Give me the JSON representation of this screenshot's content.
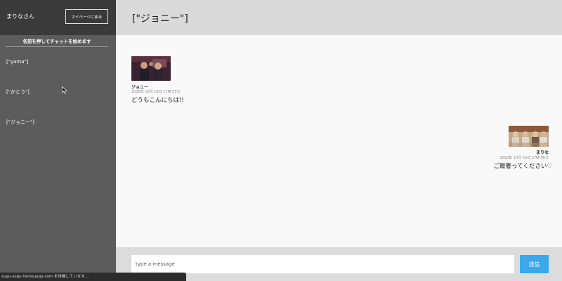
{
  "sidebar": {
    "username": "まりなさん",
    "mypage_label": "マイページに戻る",
    "instruction": "名前を押してチャットを始めます",
    "rooms": [
      {
        "label": "[\"yama\"]"
      },
      {
        "label": "[\"かとう\"]"
      },
      {
        "label": "[\"ジョニー\"]"
      }
    ]
  },
  "header": {
    "title": "[\"ジョニー\"]"
  },
  "messages": [
    {
      "sender": "ジョニー",
      "time": "2020年 10月 16日 17時 05分",
      "text": "どうもこんにちは!!",
      "side": "left"
    },
    {
      "sender": "まりな",
      "time": "2020年 10月 16日 17時 06分",
      "text": "ご飯奢ってください♡",
      "side": "right"
    }
  ],
  "composer": {
    "placeholder": "type a message",
    "send_label": "送信"
  },
  "statusbar": {
    "text": "sugu-sugu.herokuapp.com を待機しています..."
  },
  "colors": {
    "sidebar_bg": "#5c5c5c",
    "sidebar_header_bg": "#3a3a3a",
    "send_button": "#3aa8ea",
    "topbar_bg": "#dadada"
  }
}
